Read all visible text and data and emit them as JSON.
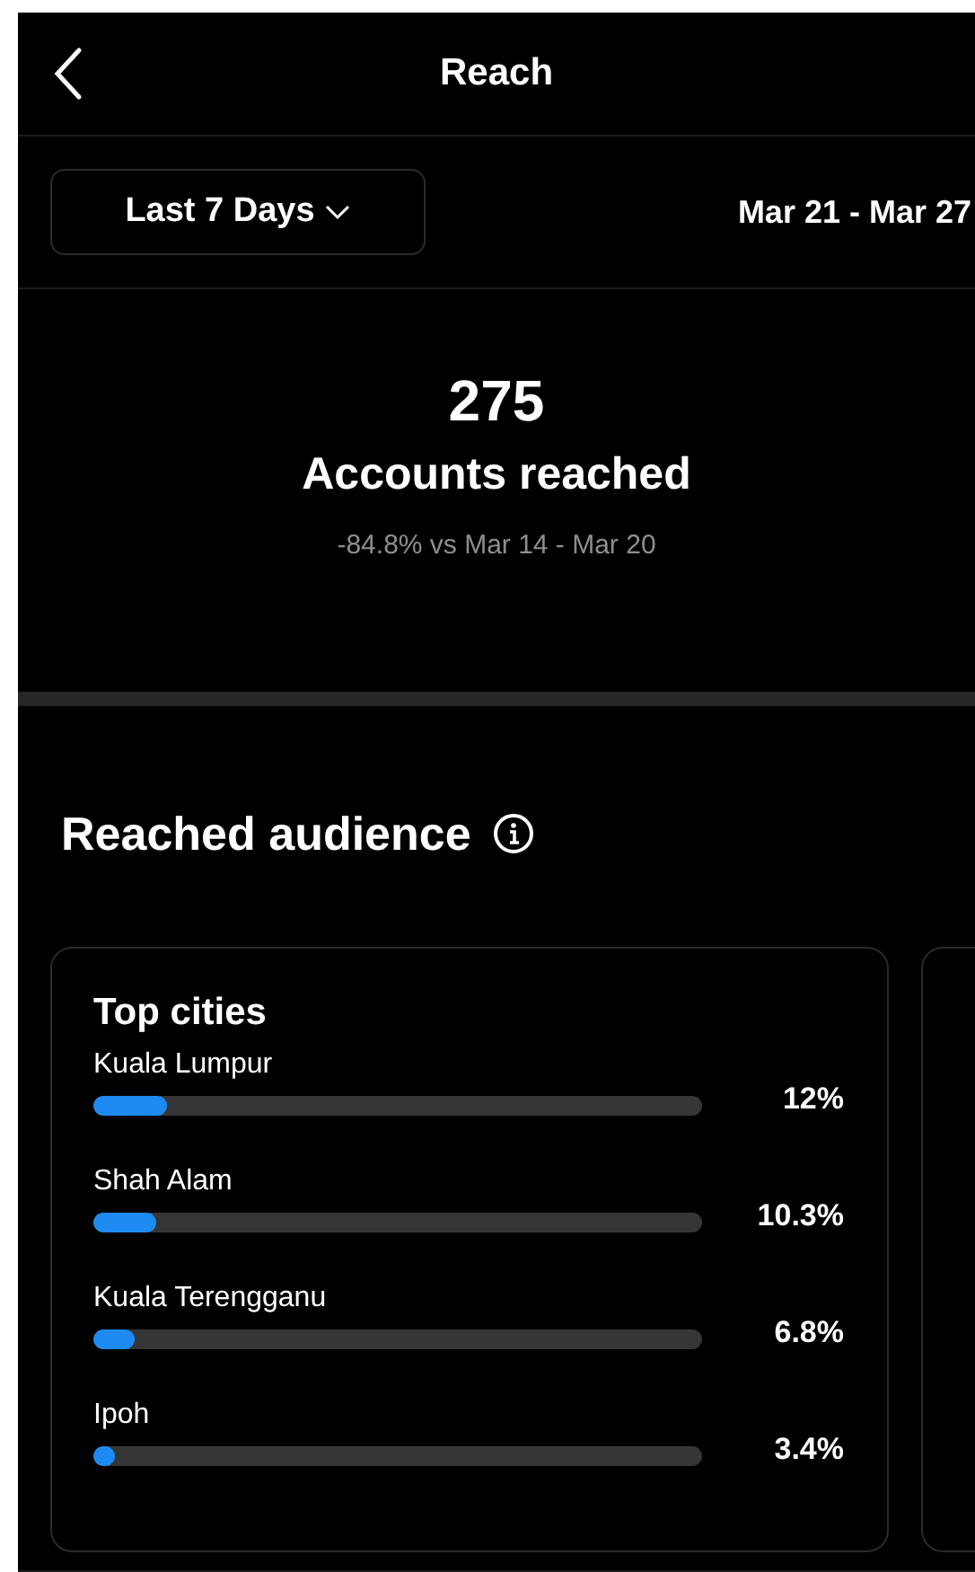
{
  "header": {
    "title": "Reach"
  },
  "period": {
    "label": "Last 7 Days",
    "range": "Mar 21 - Mar 27"
  },
  "summary": {
    "value": "275",
    "label": "Accounts reached",
    "comparison": "-84.8% vs Mar 14 - Mar 20"
  },
  "section": {
    "title": "Reached audience"
  },
  "cards": [
    {
      "kind": "list",
      "title": "Top cities",
      "rows": [
        {
          "label": "Kuala Lumpur",
          "level": 0.12,
          "reading": "12%"
        },
        {
          "label": "Shah Alam",
          "level": 0.103,
          "reading": "10.3%"
        },
        {
          "label": "Kuala Terengganu",
          "level": 0.068,
          "reading": "6.8%"
        },
        {
          "label": "Ipoh",
          "level": 0.034,
          "reading": "3.4%"
        }
      ]
    },
    {
      "kind": "peek"
    }
  ]
}
